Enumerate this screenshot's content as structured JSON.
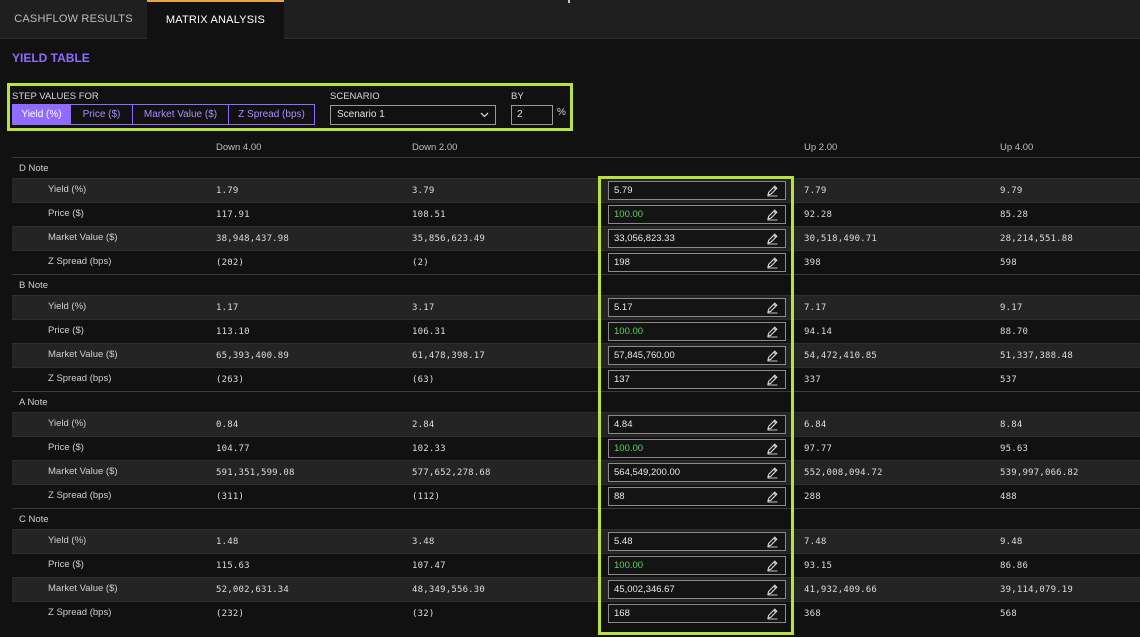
{
  "tabs": [
    {
      "label": "CASHFLOW RESULTS",
      "active": false
    },
    {
      "label": "MATRIX ANALYSIS",
      "active": true
    }
  ],
  "section_title": "YIELD TABLE",
  "controls": {
    "step_label": "STEP VALUES FOR",
    "step_options": [
      "Yield (%)",
      "Price ($)",
      "Market Value ($)",
      "Z Spread (bps)"
    ],
    "step_selected": "Yield (%)",
    "scenario_label": "SCENARIO",
    "scenario_value": "Scenario 1",
    "by_label": "BY",
    "by_value": "2",
    "by_unit": "%"
  },
  "columns": [
    "Down 4.00",
    "Down 2.00",
    "",
    "Up 2.00",
    "Up 4.00"
  ],
  "groups": [
    {
      "name": "D Note",
      "rows": [
        {
          "label": "Yield (%)",
          "values": [
            "1.79",
            "3.79",
            "5.79",
            "7.79",
            "9.79"
          ]
        },
        {
          "label": "Price ($)",
          "values": [
            "117.91",
            "108.51",
            "100.00",
            "92.28",
            "85.28"
          ]
        },
        {
          "label": "Market Value ($)",
          "values": [
            "38,948,437.98",
            "35,856,623.49",
            "33,056,823.33",
            "30,518,490.71",
            "28,214,551.88"
          ]
        },
        {
          "label": "Z Spread (bps)",
          "values": [
            "(202)",
            "(2)",
            "198",
            "398",
            "598"
          ]
        }
      ]
    },
    {
      "name": "B Note",
      "rows": [
        {
          "label": "Yield (%)",
          "values": [
            "1.17",
            "3.17",
            "5.17",
            "7.17",
            "9.17"
          ]
        },
        {
          "label": "Price ($)",
          "values": [
            "113.10",
            "106.31",
            "100.00",
            "94.14",
            "88.70"
          ]
        },
        {
          "label": "Market Value ($)",
          "values": [
            "65,393,400.89",
            "61,478,398.17",
            "57,845,760.00",
            "54,472,410.85",
            "51,337,388.48"
          ]
        },
        {
          "label": "Z Spread (bps)",
          "values": [
            "(263)",
            "(63)",
            "137",
            "337",
            "537"
          ]
        }
      ]
    },
    {
      "name": "A Note",
      "rows": [
        {
          "label": "Yield (%)",
          "values": [
            "0.84",
            "2.84",
            "4.84",
            "6.84",
            "8.84"
          ]
        },
        {
          "label": "Price ($)",
          "values": [
            "104.77",
            "102.33",
            "100.00",
            "97.77",
            "95.63"
          ]
        },
        {
          "label": "Market Value ($)",
          "values": [
            "591,351,599.08",
            "577,652,278.68",
            "564,549,200.00",
            "552,008,094.72",
            "539,997,066.82"
          ]
        },
        {
          "label": "Z Spread (bps)",
          "values": [
            "(311)",
            "(112)",
            "88",
            "288",
            "488"
          ]
        }
      ]
    },
    {
      "name": "C Note",
      "rows": [
        {
          "label": "Yield (%)",
          "values": [
            "1.48",
            "3.48",
            "5.48",
            "7.48",
            "9.48"
          ]
        },
        {
          "label": "Price ($)",
          "values": [
            "115.63",
            "107.47",
            "100.00",
            "93.15",
            "86.86"
          ]
        },
        {
          "label": "Market Value ($)",
          "values": [
            "52,002,631.34",
            "48,349,556.30",
            "45,002,346.67",
            "41,932,409.66",
            "39,114,079.19"
          ]
        },
        {
          "label": "Z Spread (bps)",
          "values": [
            "(232)",
            "(32)",
            "168",
            "368",
            "568"
          ]
        }
      ]
    }
  ],
  "colors": {
    "accent": "#8f6cff",
    "highlight": "#b9e23a",
    "tab_indicator": "#f0a040",
    "price_text": "#5fd35f"
  },
  "icons": {
    "edit": "pencil-icon",
    "dropdown": "chevron-down-icon"
  }
}
